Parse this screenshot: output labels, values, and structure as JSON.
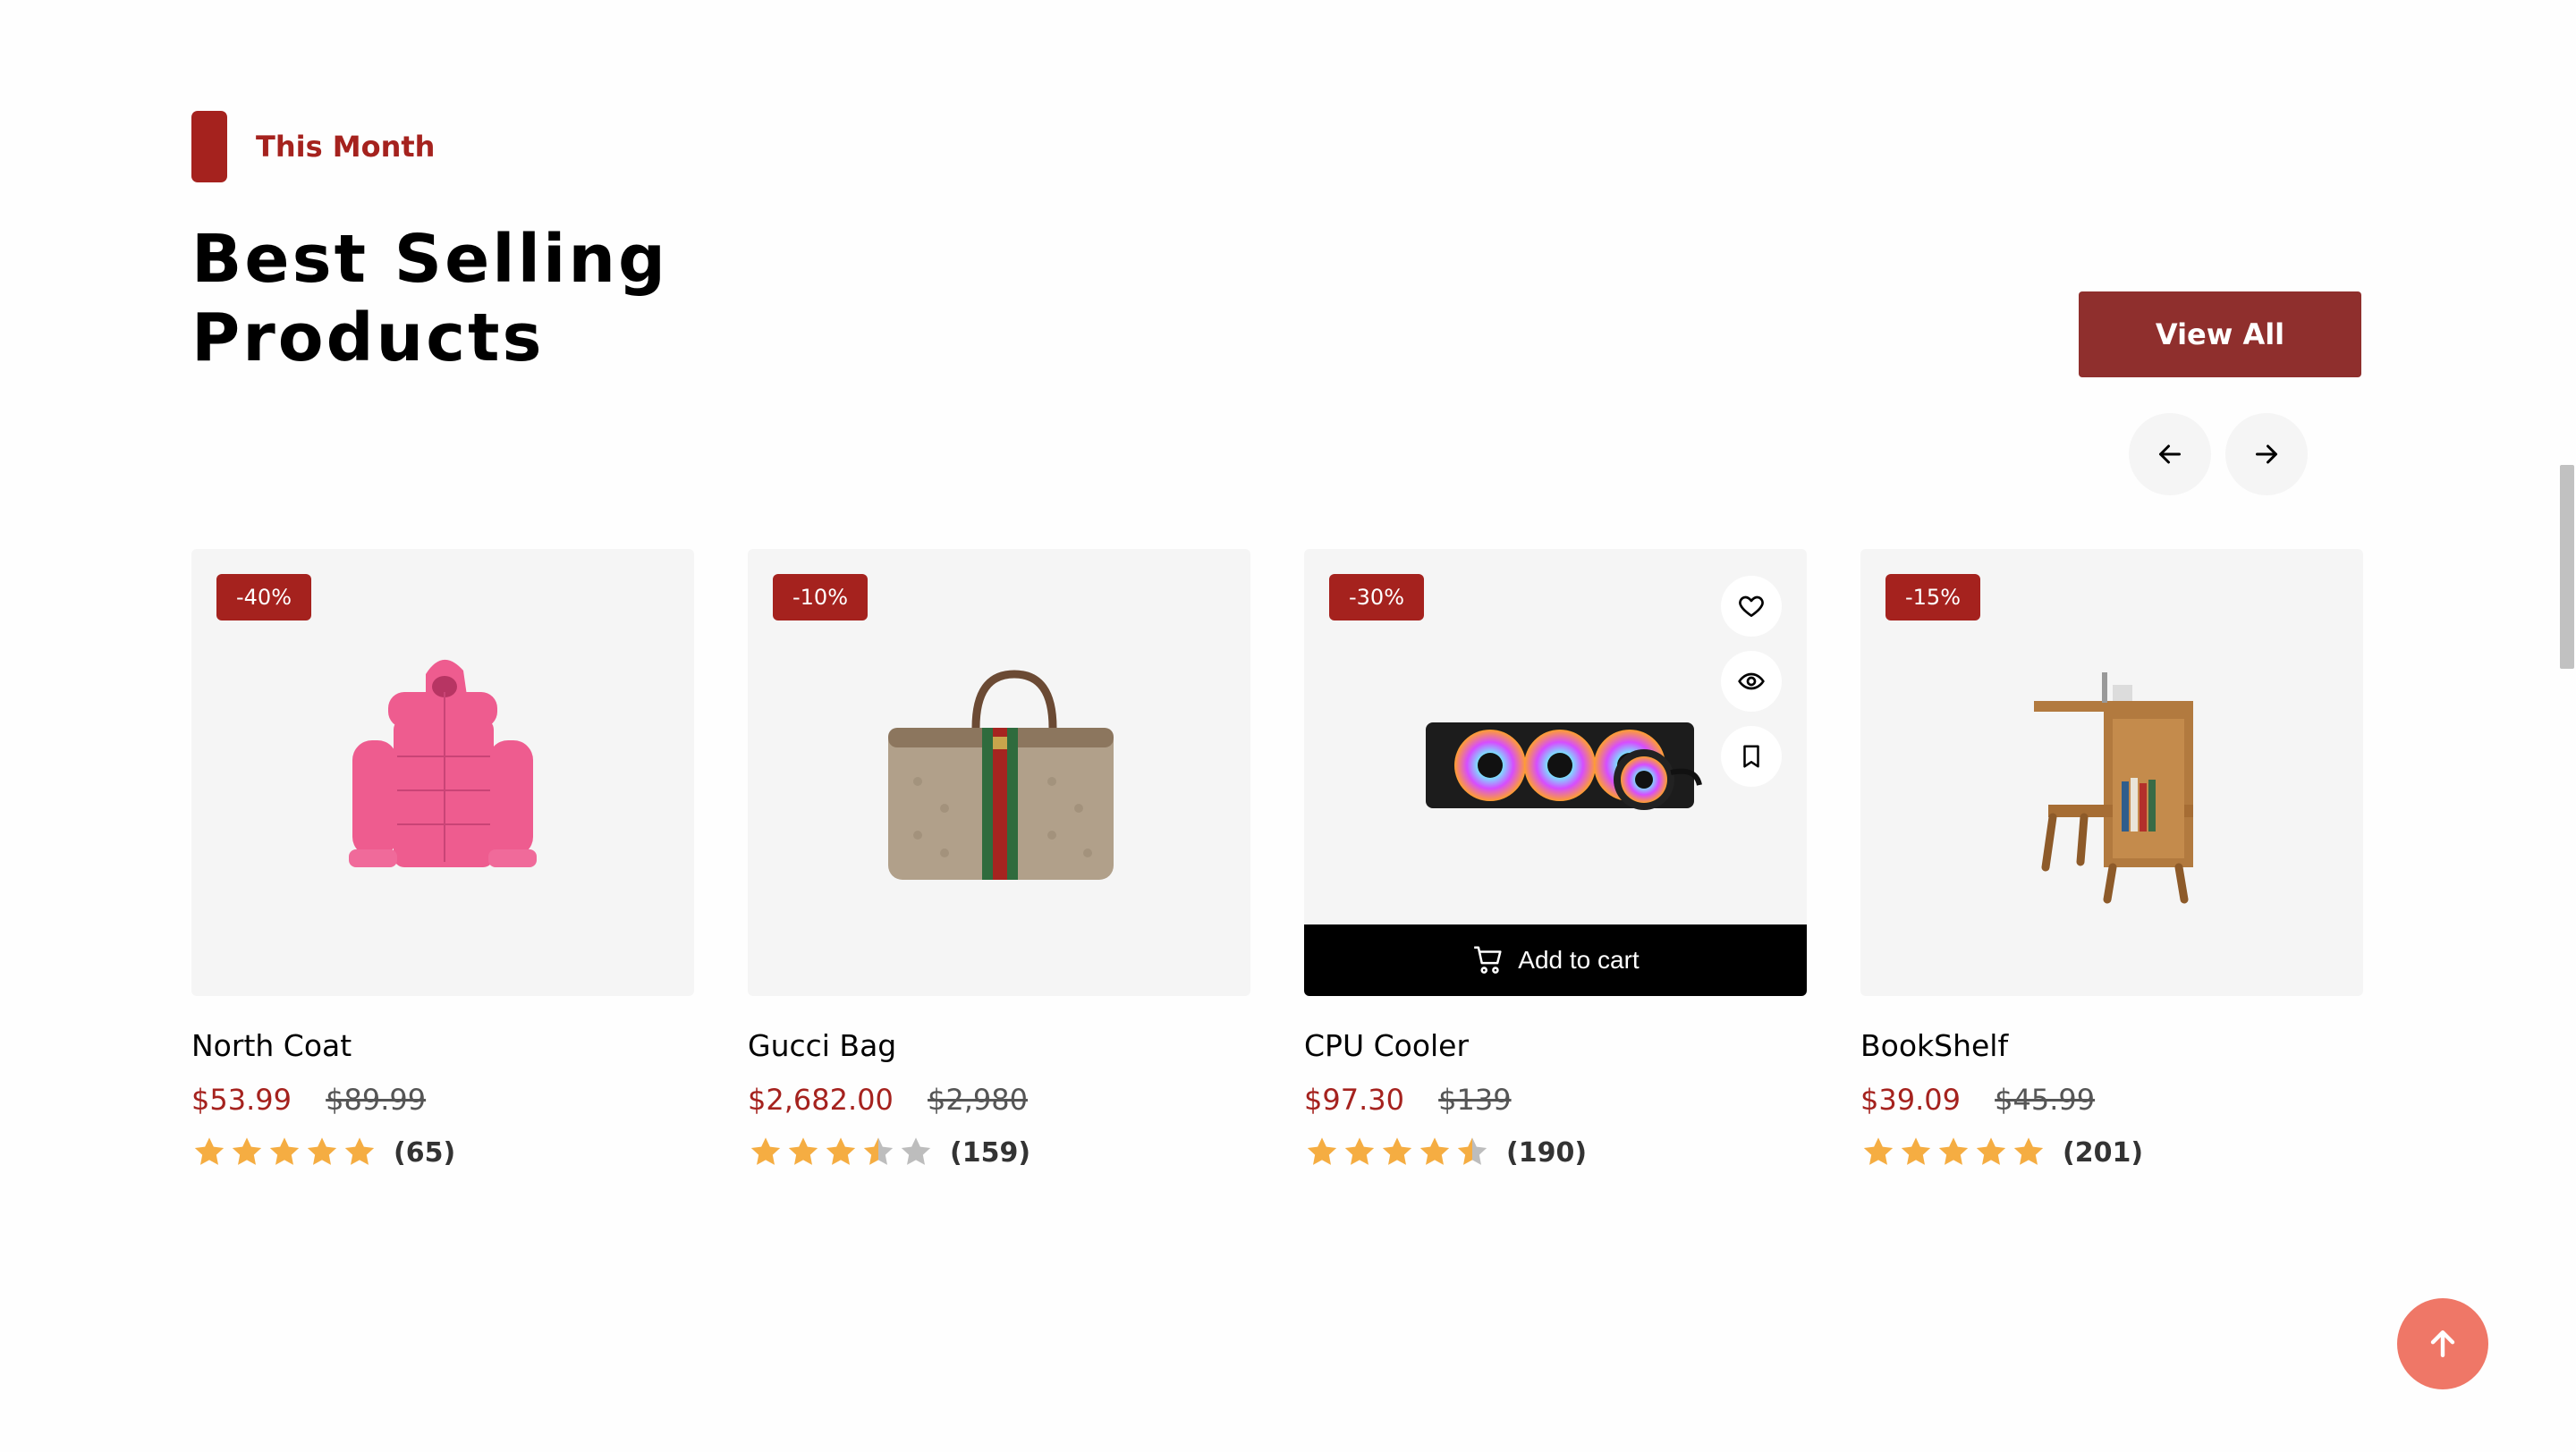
{
  "section": {
    "tag": "This Month",
    "title_line1": "Best Selling",
    "title_line2": "Products",
    "view_all": "View All"
  },
  "colors": {
    "accent": "#a5221e",
    "button": "#8f2f2d",
    "star": "#f5ad42",
    "star_empty": "#bdbdbd",
    "to_top": "#ef7767"
  },
  "products": [
    {
      "name": "North Coat",
      "discount": "-40%",
      "price": "$53.99",
      "old_price": "$89.99",
      "rating": 5,
      "reviews": "(65)",
      "image": "pink-puffer-coat"
    },
    {
      "name": "Gucci Bag",
      "discount": "-10%",
      "price": "$2,682.00",
      "old_price": "$2,980",
      "rating": 3.5,
      "reviews": "(159)",
      "image": "gucci-duffel-bag"
    },
    {
      "name": "CPU Cooler",
      "discount": "-30%",
      "price": "$97.30",
      "old_price": "$139",
      "rating": 4.5,
      "reviews": "(190)",
      "image": "rgb-cpu-cooler",
      "hovered": true,
      "add_to_cart": "Add to cart"
    },
    {
      "name": "BookShelf",
      "discount": "-15%",
      "price": "$39.09",
      "old_price": "$45.99",
      "rating": 5,
      "reviews": "(201)",
      "image": "wooden-bookshelf"
    }
  ],
  "icons": {
    "prev": "arrow-left-icon",
    "next": "arrow-right-icon",
    "wishlist": "heart-icon",
    "quick_view": "eye-icon",
    "save": "bookmark-icon",
    "cart": "cart-icon",
    "to_top": "arrow-up-icon"
  }
}
